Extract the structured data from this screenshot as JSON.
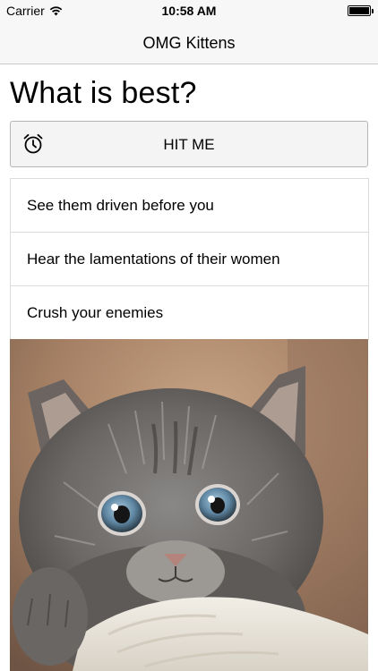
{
  "status_bar": {
    "carrier": "Carrier",
    "time": "10:58 AM",
    "wifi_icon": "wifi-icon",
    "battery_icon": "battery-icon"
  },
  "nav": {
    "title": "OMG Kittens"
  },
  "page": {
    "title": "What is best?"
  },
  "action_button": {
    "label": "HIT ME",
    "icon": "alarm-clock-icon"
  },
  "options": [
    {
      "label": "See them driven before you"
    },
    {
      "label": "Hear the lamentations of their women"
    },
    {
      "label": "Crush your enemies"
    }
  ],
  "image": {
    "subject": "kitten-photo"
  },
  "colors": {
    "bar_background": "#f7f7f7",
    "button_background": "#f4f4f4",
    "divider": "#dcdcdc"
  }
}
